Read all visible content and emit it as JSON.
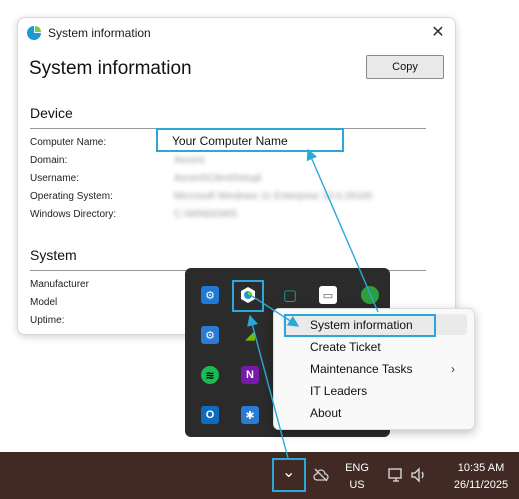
{
  "window": {
    "title": "System information",
    "heading": "System information",
    "copy_label": "Copy",
    "close_glyph": "✕"
  },
  "device": {
    "heading": "Device",
    "fields": [
      {
        "label": "Computer Name:",
        "value": "Your Computer Name"
      },
      {
        "label": "Domain:",
        "value": "Ascent"
      },
      {
        "label": "Username:",
        "value": "Ascent\\ClientSetupl"
      },
      {
        "label": "Operating System:",
        "value": "Microsoft Windows 11 Enterprise 10.0.26100"
      },
      {
        "label": "Windows Directory:",
        "value": "C:\\WINDOWS"
      }
    ]
  },
  "system": {
    "heading": "System",
    "fields": [
      {
        "label": "Manufacturer"
      },
      {
        "label": "Model"
      },
      {
        "label": "Uptime:"
      }
    ]
  },
  "tray_icons": [
    {
      "name": "settings-gear-icon",
      "glyph": "⚙",
      "color": "#1f7ad6"
    },
    {
      "name": "system-info-app-icon",
      "glyph": "◆",
      "color": "#2aa8d8"
    },
    {
      "name": "window-icon",
      "glyph": "▢",
      "color": "#1aa79a"
    },
    {
      "name": "chat-icon",
      "glyph": "▭",
      "color": "#555555"
    },
    {
      "name": "xbox-icon",
      "glyph": "●",
      "color": "#2e9e3e"
    },
    {
      "name": "gear-icon",
      "glyph": "⚙",
      "color": "#2a7bd3"
    },
    {
      "name": "nvidia-icon",
      "glyph": "◢",
      "color": "#76b900"
    },
    {
      "name": "spotify-icon",
      "glyph": "≋",
      "color": "#1db954"
    },
    {
      "name": "onenote-icon",
      "glyph": "N",
      "color": "#7719aa"
    },
    {
      "name": "outlook-icon",
      "glyph": "O",
      "color": "#0f6cbd"
    },
    {
      "name": "alert-icon",
      "glyph": "✱",
      "color": "#2a7bd3"
    }
  ],
  "context_menu": {
    "items": [
      "System information",
      "Create Ticket",
      "Maintenance Tasks",
      "IT Leaders",
      "About"
    ],
    "submenu_glyph": "›"
  },
  "taskbar": {
    "chevron_glyph": "⌄",
    "language": "ENG",
    "region": "US",
    "time": "10:35 AM",
    "date": "26/11/2025"
  },
  "colors": {
    "highlight": "#2aa8d8",
    "taskbar": "#412a24",
    "tray_bg": "#2b2b2b"
  }
}
